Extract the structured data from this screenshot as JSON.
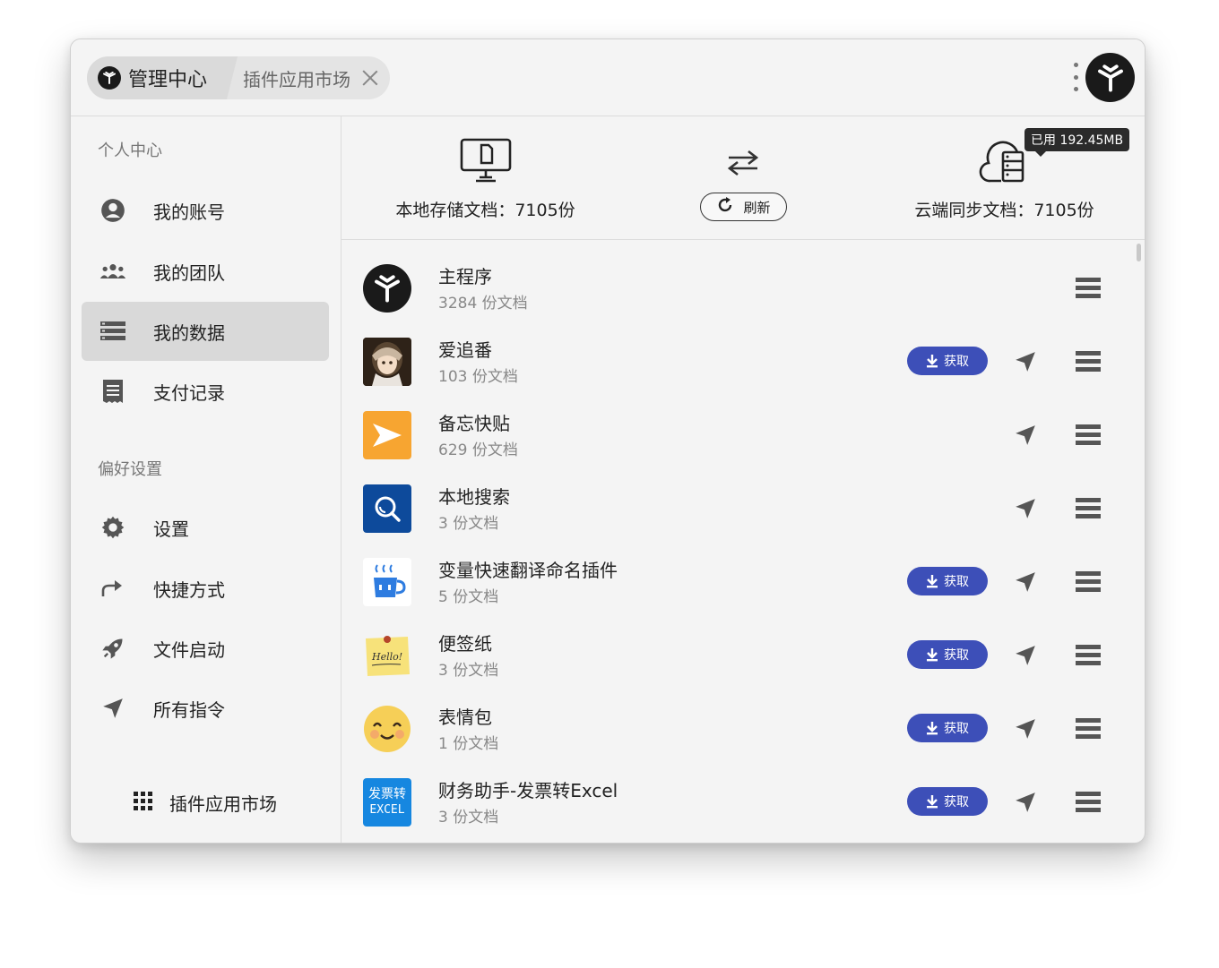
{
  "tabs": {
    "main_label": "管理中心",
    "second_label": "插件应用市场"
  },
  "sidebar": {
    "section1_title": "个人中心",
    "items": [
      {
        "label": "我的账号",
        "icon": "account-circle-icon"
      },
      {
        "label": "我的团队",
        "icon": "team-icon"
      },
      {
        "label": "我的数据",
        "icon": "data-list-icon",
        "active": true
      },
      {
        "label": "支付记录",
        "icon": "receipt-icon"
      }
    ],
    "section2_title": "偏好设置",
    "prefs": [
      {
        "label": "设置",
        "icon": "gear-icon"
      },
      {
        "label": "快捷方式",
        "icon": "share-arrow-icon"
      },
      {
        "label": "文件启动",
        "icon": "rocket-icon"
      },
      {
        "label": "所有指令",
        "icon": "send-icon"
      }
    ],
    "market_label": "插件应用市场"
  },
  "stats": {
    "local_label": "本地存储文档：7105份",
    "refresh_label": "刷新",
    "cloud_label": "云端同步文档：7105份",
    "used_badge": "已用 192.45MB"
  },
  "plugins": [
    {
      "name": "主程序",
      "count": "3284 份文档",
      "icon": "app-logo-icon",
      "has_get": false,
      "has_send": false
    },
    {
      "name": "爱追番",
      "count": "103 份文档",
      "icon": "anime-avatar-icon",
      "has_get": true,
      "has_send": true
    },
    {
      "name": "备忘快贴",
      "count": "629 份文档",
      "icon": "memo-star-icon",
      "has_get": false,
      "has_send": true
    },
    {
      "name": "本地搜索",
      "count": "3 份文档",
      "icon": "local-search-icon",
      "has_get": false,
      "has_send": true
    },
    {
      "name": "变量快速翻译命名插件",
      "count": "5 份文档",
      "icon": "coffee-cup-icon",
      "has_get": true,
      "has_send": true
    },
    {
      "name": "便签纸",
      "count": "3 份文档",
      "icon": "sticky-note-icon",
      "has_get": true,
      "has_send": true
    },
    {
      "name": "表情包",
      "count": "1 份文档",
      "icon": "smiley-face-icon",
      "has_get": true,
      "has_send": true
    },
    {
      "name": "财务助手-发票转Excel",
      "count": "3 份文档",
      "icon": "invoice-excel-icon",
      "has_get": true,
      "has_send": true
    }
  ],
  "get_label": "获取",
  "invoice_icon_text": {
    "line1": "发票转",
    "line2": "EXCEL"
  },
  "sticky_note_text": "Hello!",
  "colors": {
    "accent": "#3d4fb8",
    "memo": "#f7a531",
    "search": "#0d4a9b",
    "invoice": "#1687e0"
  }
}
